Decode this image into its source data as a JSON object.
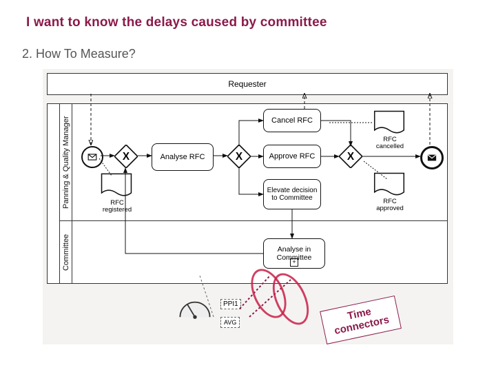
{
  "title": "I want to know the delays caused by committee",
  "subtitle": "2. How To Measure?",
  "pools": {
    "requester": "Requester",
    "lane_pm": "Panning & Quality Manager",
    "lane_committee": "Committee"
  },
  "tasks": {
    "analyse_rfc": "Analyse RFC",
    "cancel_rfc": "Cancel RFC",
    "approve_rfc": "Approve RFC",
    "elevate": "Elevate decision to Committee",
    "analyse_committee": "Analyse in Committee"
  },
  "docs": {
    "rfc_registered": "RFC registered",
    "rfc_cancelled": "RFC cancelled",
    "rfc_approved": "RFC approved"
  },
  "annotation": {
    "line1": "Time",
    "line2": "connectors"
  },
  "ppi": "PPI1",
  "avg": "AVG"
}
